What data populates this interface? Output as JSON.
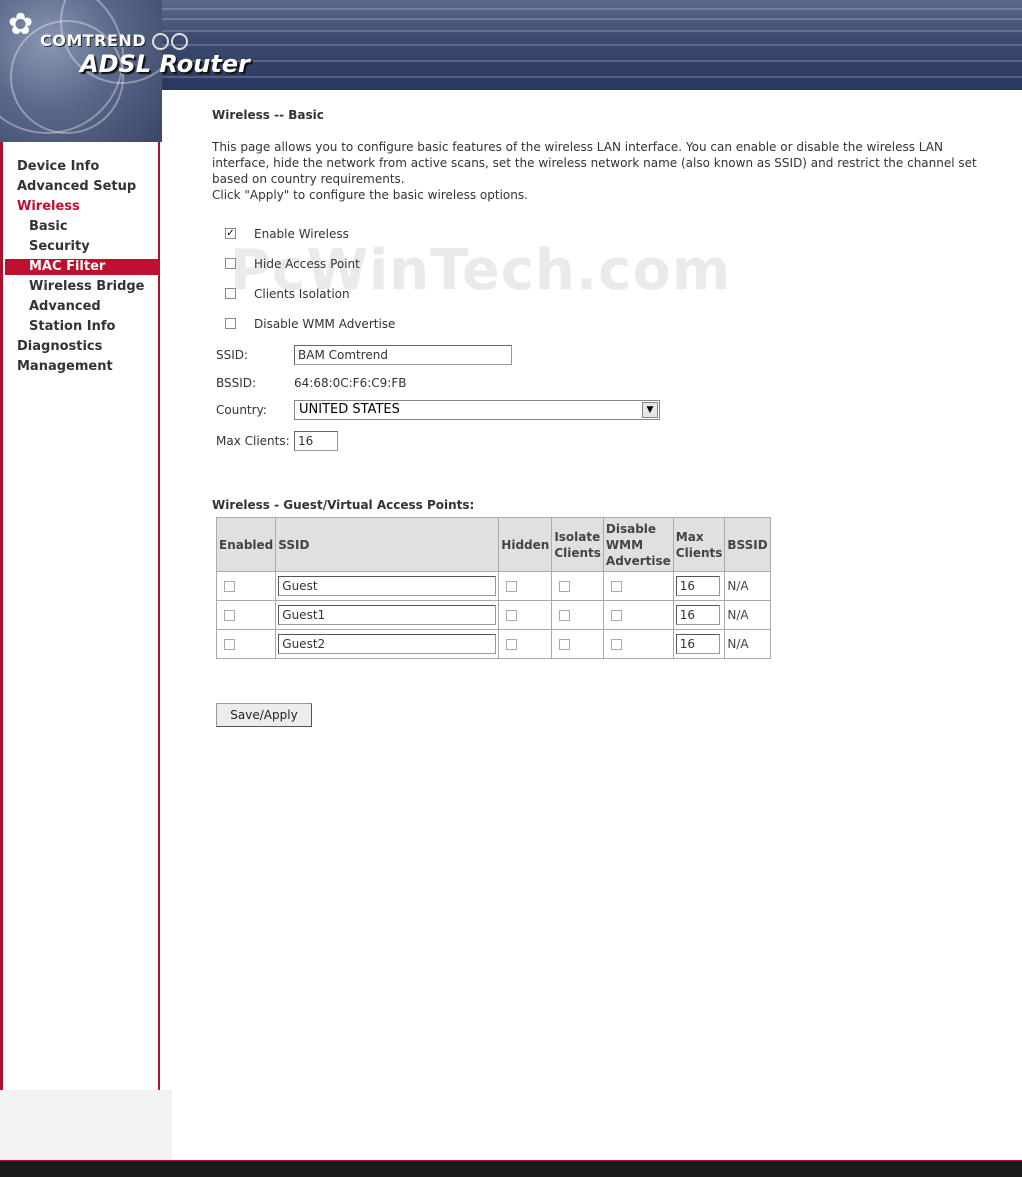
{
  "header": {
    "brand": "COMTREND",
    "product": "ADSL Router"
  },
  "sidebar": {
    "items": [
      {
        "label": "Device Info",
        "level": "top"
      },
      {
        "label": "Advanced Setup",
        "level": "top"
      },
      {
        "label": "Wireless",
        "level": "top",
        "state": "active-parent"
      },
      {
        "label": "Basic",
        "level": "sub"
      },
      {
        "label": "Security",
        "level": "sub"
      },
      {
        "label": "MAC Filter",
        "level": "sub",
        "state": "selected"
      },
      {
        "label": "Wireless Bridge",
        "level": "sub"
      },
      {
        "label": "Advanced",
        "level": "sub"
      },
      {
        "label": "Station Info",
        "level": "sub"
      },
      {
        "label": "Diagnostics",
        "level": "top"
      },
      {
        "label": "Management",
        "level": "top"
      }
    ]
  },
  "main": {
    "title": "Wireless -- Basic",
    "description": [
      "This page allows you to configure basic features of the wireless LAN interface. You can enable or disable the wireless LAN",
      "interface, hide the network from active scans, set the wireless network name (also known as SSID) and restrict the channel set",
      "based on country requirements.",
      "Click \"Apply\" to configure the basic wireless options."
    ],
    "options": [
      {
        "label": "Enable Wireless",
        "checked": true
      },
      {
        "label": "Hide Access Point",
        "checked": false
      },
      {
        "label": "Clients Isolation",
        "checked": false
      },
      {
        "label": "Disable WMM Advertise",
        "checked": false
      }
    ],
    "ssid": {
      "label": "SSID:",
      "value": "BAM Comtrend"
    },
    "bssid": {
      "label": "BSSID:",
      "value": "64:68:0C:F6:C9:FB"
    },
    "country": {
      "label": "Country:",
      "value": "UNITED STATES"
    },
    "max_clients": {
      "label": "Max Clients:",
      "value": "16"
    },
    "watermark": "PcWinTech.com"
  },
  "guest": {
    "title": "Wireless - Guest/Virtual Access Points:",
    "columns": [
      "Enabled",
      "SSID",
      "Hidden",
      "Isolate Clients",
      "Disable WMM Advertise",
      "Max Clients",
      "BSSID"
    ],
    "rows": [
      {
        "enabled": false,
        "ssid": "Guest",
        "hidden": false,
        "isolate": false,
        "disable_wmm": false,
        "max_clients": "16",
        "bssid": "N/A"
      },
      {
        "enabled": false,
        "ssid": "Guest1",
        "hidden": false,
        "isolate": false,
        "disable_wmm": false,
        "max_clients": "16",
        "bssid": "N/A"
      },
      {
        "enabled": false,
        "ssid": "Guest2",
        "hidden": false,
        "isolate": false,
        "disable_wmm": false,
        "max_clients": "16",
        "bssid": "N/A"
      }
    ]
  },
  "actions": {
    "save_label": "Save/Apply"
  },
  "colors": {
    "accent": "#c0102f",
    "header": "#3b4a6e"
  }
}
